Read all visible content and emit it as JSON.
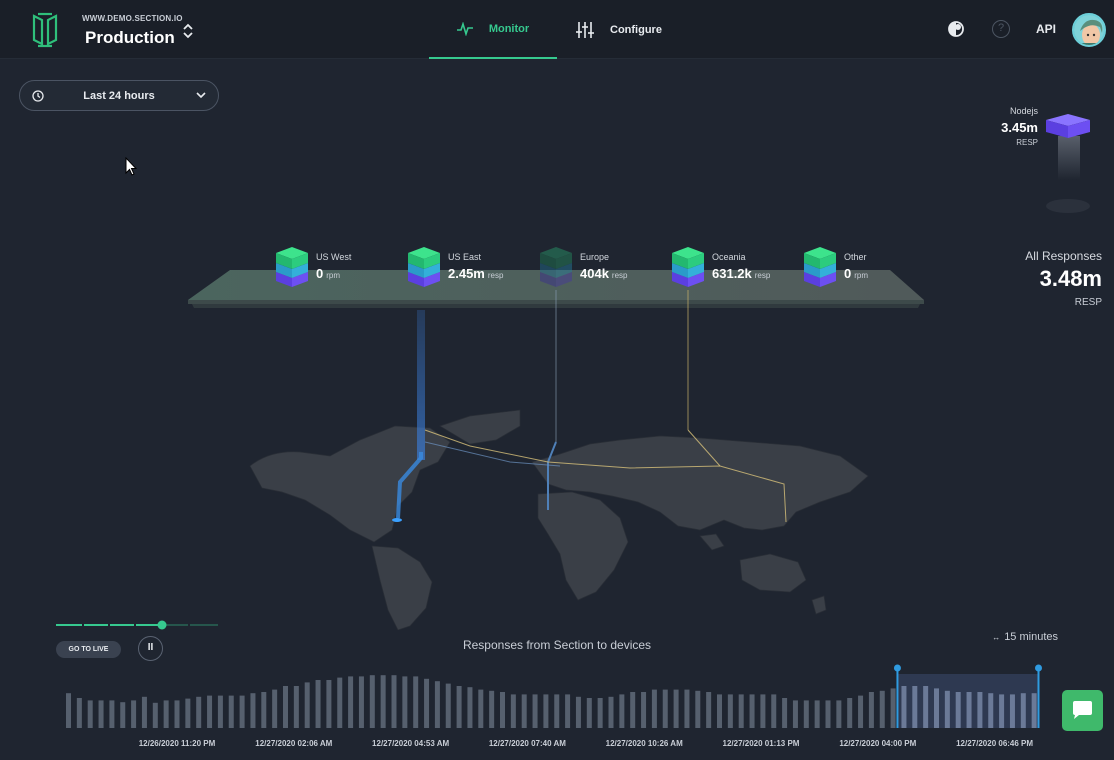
{
  "header": {
    "site_url": "WWW.DEMO.SECTION.IO",
    "environment": "Production",
    "tabs": [
      {
        "label": "Monitor",
        "active": true
      },
      {
        "label": "Configure",
        "active": false
      }
    ],
    "help_symbol": "?",
    "api_label": "API"
  },
  "filters": {
    "time_range": "Last 24 hours"
  },
  "nodejs": {
    "name": "Nodejs",
    "value": "3.45m",
    "unit": "RESP"
  },
  "all_responses": {
    "title": "All Responses",
    "value": "3.48m",
    "unit": "RESP"
  },
  "regions": [
    {
      "name": "US West",
      "value": "0",
      "unit": "rpm"
    },
    {
      "name": "US East",
      "value": "2.45m",
      "unit": "resp"
    },
    {
      "name": "Europe",
      "value": "404k",
      "unit": "resp"
    },
    {
      "name": "Oceania",
      "value": "631.2k",
      "unit": "resp"
    },
    {
      "name": "Other",
      "value": "0",
      "unit": "rpm"
    }
  ],
  "playback": {
    "goto_live": "GO TO LIVE",
    "pause_symbol": "II"
  },
  "timeline_chart": {
    "title": "Responses from Section to devices",
    "interval": "15 minutes",
    "x_labels": [
      "12/26/2020 11:20 PM",
      "12/27/2020 02:06 AM",
      "12/27/2020 04:53 AM",
      "12/27/2020 07:40 AM",
      "12/27/2020 10:26 AM",
      "12/27/2020 01:13 PM",
      "12/27/2020 04:00 PM",
      "12/27/2020 06:46 PM"
    ],
    "values": [
      0.58,
      0.5,
      0.46,
      0.46,
      0.46,
      0.43,
      0.46,
      0.52,
      0.42,
      0.46,
      0.46,
      0.49,
      0.52,
      0.54,
      0.54,
      0.54,
      0.54,
      0.58,
      0.6,
      0.64,
      0.7,
      0.7,
      0.76,
      0.8,
      0.8,
      0.84,
      0.86,
      0.86,
      0.88,
      0.88,
      0.88,
      0.86,
      0.86,
      0.82,
      0.78,
      0.74,
      0.7,
      0.68,
      0.64,
      0.62,
      0.6,
      0.56,
      0.56,
      0.56,
      0.56,
      0.56,
      0.56,
      0.52,
      0.5,
      0.5,
      0.52,
      0.56,
      0.6,
      0.6,
      0.64,
      0.64,
      0.64,
      0.64,
      0.62,
      0.6,
      0.56,
      0.56,
      0.56,
      0.56,
      0.56,
      0.56,
      0.5,
      0.46,
      0.46,
      0.46,
      0.46,
      0.46,
      0.5,
      0.54,
      0.6,
      0.62,
      0.66,
      0.7,
      0.7,
      0.7,
      0.66,
      0.62,
      0.6,
      0.6,
      0.6,
      0.58,
      0.56,
      0.56,
      0.58,
      0.58
    ],
    "selection": {
      "start_label": "12/27/2020 04:00 PM",
      "end_label": "12/27/2020 06:46 PM"
    }
  },
  "colors": {
    "accent": "#36c98f",
    "background": "#1f2530",
    "bar": "#56606e",
    "selection": "#2f9be0",
    "chat": "#3fb96b"
  },
  "icons": [
    "section-logo-icon",
    "chevron-updown-icon",
    "monitor-pulse-icon",
    "configure-sliders-icon",
    "theme-toggle-icon",
    "help-icon",
    "avatar",
    "clock-icon",
    "chevron-down-icon",
    "cursor-icon",
    "chat-icon"
  ]
}
